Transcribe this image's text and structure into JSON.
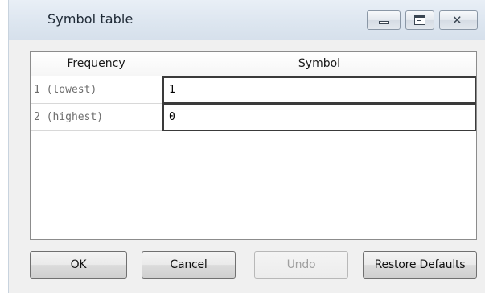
{
  "window": {
    "title": "Symbol table",
    "controls": {
      "minimize": "minimize-icon",
      "maximize": "maximize-icon",
      "close": "close-icon"
    }
  },
  "table": {
    "columns": [
      "Frequency",
      "Symbol"
    ],
    "rows": [
      {
        "frequency": "1 (lowest)",
        "symbol": "1"
      },
      {
        "frequency": "2 (highest)",
        "symbol": "0"
      }
    ]
  },
  "buttons": {
    "ok": "OK",
    "cancel": "Cancel",
    "undo": "Undo",
    "restore": "Restore Defaults"
  },
  "colors": {
    "titlebar": "#dde6f0",
    "window_bg": "#f0f0f0",
    "disabled_text": "#a0a0a0"
  }
}
